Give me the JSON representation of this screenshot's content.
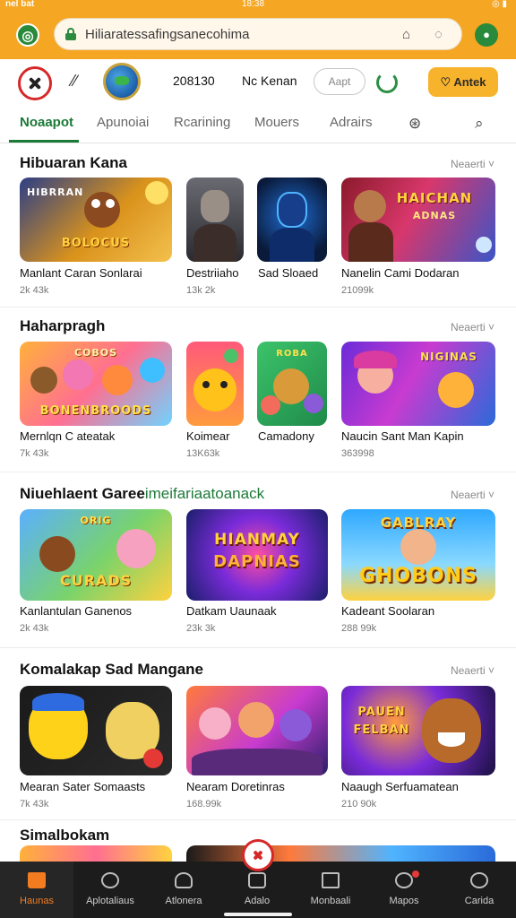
{
  "status_bar": {
    "carrier": "nel bat",
    "time": "18:38",
    "battery": "◎ ▮"
  },
  "browser": {
    "url": "Hiliaratessafingsanecohima"
  },
  "header": {
    "number": "208130",
    "label": "Nc Kenan",
    "input_placeholder": "Aapt",
    "cta_label": "Antek"
  },
  "tabs": [
    {
      "label": "Noaapot",
      "active": true
    },
    {
      "label": "Apunoiai",
      "active": false
    },
    {
      "label": "Rcarining",
      "active": false
    },
    {
      "label": "Mouers",
      "active": false
    },
    {
      "label": "Adrairs",
      "active": false
    }
  ],
  "sections": [
    {
      "title": "Hibuaran Kana",
      "title_highlight": "",
      "more": "Neaerti ˅",
      "items": [
        {
          "name": "Manlant Caran Sonlarai",
          "meta": "2k 43k",
          "art_text": "HIBRRAN | BOLOCUS"
        },
        {
          "name": "Destriiaho",
          "meta": "13k 2k",
          "art_text": ""
        },
        {
          "name": "Sad Sloaed",
          "meta": "",
          "art_text": ""
        },
        {
          "name": "Nanelin Cami Dodaran",
          "meta": "21099k",
          "art_text": "HAICHAN | ADNAS"
        }
      ]
    },
    {
      "title": "Haharpragh",
      "title_highlight": "",
      "more": "Neaerti ˅",
      "items": [
        {
          "name": "Mernlqn C ateatak",
          "meta": "7k 43k",
          "art_text": "BONENBROODS"
        },
        {
          "name": "Koimear",
          "meta": "13K63k",
          "art_text": ""
        },
        {
          "name": "Camadony",
          "meta": "",
          "art_text": ""
        },
        {
          "name": "Naucin Sant Man Kapin",
          "meta": "363998",
          "art_text": "NIGINAS"
        }
      ]
    },
    {
      "title": "Niuehlaent Garee",
      "title_highlight": "imeifariaatoanack",
      "more": "Neaerti ˅",
      "items": [
        {
          "name": "Kanlantulan Ganenos",
          "meta": "2k 43k",
          "art_text": "CURADS"
        },
        {
          "name": "Datkam Uaunaak",
          "meta": "23k 3k",
          "art_text": "HIANMAY DAPNIAS"
        },
        {
          "name": "Kadeant Soolaran",
          "meta": "288 99k",
          "art_text": "GABLRAY GHOBONS"
        }
      ]
    },
    {
      "title": "Komalakap Sad Mangane",
      "title_highlight": "",
      "more": "Neaerti ˅",
      "items": [
        {
          "name": "Mearan Sater Somaasts",
          "meta": "7k 43k",
          "art_text": ""
        },
        {
          "name": "Nearam Doretinras",
          "meta": "168.99k",
          "art_text": ""
        },
        {
          "name": "Naaugh Serfuamatean",
          "meta": "210 90k",
          "art_text": "PAUEN FELBAN"
        }
      ]
    },
    {
      "title": "Simalbokam",
      "title_highlight": "",
      "more": "",
      "items": []
    }
  ],
  "bottom_nav": [
    {
      "label": "Haunas",
      "active": true
    },
    {
      "label": "Aplotaliaus",
      "active": false
    },
    {
      "label": "Atlonera",
      "active": false
    },
    {
      "label": "Adalo",
      "active": false
    },
    {
      "label": "Monbaali",
      "active": false
    },
    {
      "label": "Mapos",
      "active": false
    },
    {
      "label": "Carida",
      "active": false
    }
  ],
  "colors": {
    "accent": "#1c7a38",
    "chrome": "#f5a623",
    "cta": "#f7b32b",
    "brand_red": "#d62828",
    "nav_bg": "#1c1c1c",
    "nav_active": "#f47c20"
  },
  "icons": [
    "browser-logo-icon",
    "lock-icon",
    "bell-icon",
    "refresh-icon",
    "menu-icon",
    "brand-logo-icon",
    "pulse-icon",
    "globe-icon",
    "reload-icon",
    "heart-icon",
    "gamepad-icon",
    "search-icon",
    "home-icon",
    "chat-icon",
    "user-icon",
    "games-icon",
    "grid-icon",
    "notification-icon",
    "profile-icon"
  ]
}
